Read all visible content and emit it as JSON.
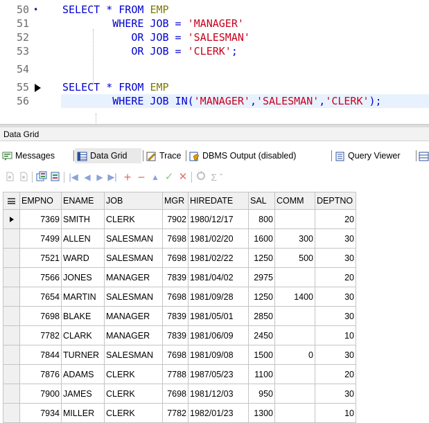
{
  "editor": {
    "lines": [
      {
        "num": "50",
        "marker": "•",
        "parts": [
          [
            "kw",
            "SELECT * FROM "
          ],
          [
            "tbl",
            "EMP"
          ]
        ]
      },
      {
        "num": "51",
        "marker": "",
        "parts": [
          [
            "kw",
            "        WHERE JOB = "
          ],
          [
            "str",
            "'MANAGER'"
          ]
        ]
      },
      {
        "num": "52",
        "marker": "",
        "parts": [
          [
            "kw",
            "           OR JOB = "
          ],
          [
            "str",
            "'SALESMAN'"
          ]
        ]
      },
      {
        "num": "53",
        "marker": "",
        "parts": [
          [
            "kw",
            "           OR JOB = "
          ],
          [
            "str",
            "'CLERK'"
          ],
          [
            "kw",
            ";"
          ]
        ]
      },
      {
        "num": "54",
        "marker": "",
        "parts": []
      },
      {
        "num": "55",
        "marker": "arrow",
        "parts": [
          [
            "kw",
            "SELECT * FROM "
          ],
          [
            "tbl",
            "EMP"
          ]
        ]
      },
      {
        "num": "56",
        "marker": "",
        "highlight": true,
        "parts": [
          [
            "kw",
            "        WHERE JOB IN("
          ],
          [
            "str",
            "'MANAGER'"
          ],
          [
            "kw",
            ","
          ],
          [
            "str",
            "'SALESMAN'"
          ],
          [
            "kw",
            ","
          ],
          [
            "str",
            "'CLERK'"
          ],
          [
            "kw",
            ");"
          ]
        ]
      }
    ]
  },
  "panel": {
    "title": "Data Grid"
  },
  "tabs": [
    {
      "label": "Messages",
      "icon": "messages-icon"
    },
    {
      "label": "Data Grid",
      "icon": "data-grid-icon",
      "active": true
    },
    {
      "label": "Trace",
      "icon": "trace-icon"
    },
    {
      "label": "DBMS Output (disabled)",
      "icon": "dbms-output-icon"
    },
    {
      "label": "Query Viewer",
      "icon": "query-viewer-icon"
    }
  ],
  "toolbar": {
    "buttons": [
      "copy-icon",
      "paste-icon",
      "export-icon",
      "import-icon",
      "first-record-icon",
      "prior-record-icon",
      "next-record-icon",
      "last-record-icon",
      "insert-record-icon",
      "delete-record-icon",
      "edit-record-icon",
      "post-edit-icon",
      "cancel-edit-icon",
      "refresh-icon",
      "sum-icon"
    ],
    "sum_label": "Σ ˇ"
  },
  "grid": {
    "columns": [
      "EMPNO",
      "ENAME",
      "JOB",
      "MGR",
      "HIREDATE",
      "SAL",
      "COMM",
      "DEPTNO"
    ],
    "rows": [
      [
        "7369",
        "SMITH",
        "CLERK",
        "7902",
        "1980/12/17",
        "800",
        "",
        "20"
      ],
      [
        "7499",
        "ALLEN",
        "SALESMAN",
        "7698",
        "1981/02/20",
        "1600",
        "300",
        "30"
      ],
      [
        "7521",
        "WARD",
        "SALESMAN",
        "7698",
        "1981/02/22",
        "1250",
        "500",
        "30"
      ],
      [
        "7566",
        "JONES",
        "MANAGER",
        "7839",
        "1981/04/02",
        "2975",
        "",
        "20"
      ],
      [
        "7654",
        "MARTIN",
        "SALESMAN",
        "7698",
        "1981/09/28",
        "1250",
        "1400",
        "30"
      ],
      [
        "7698",
        "BLAKE",
        "MANAGER",
        "7839",
        "1981/05/01",
        "2850",
        "",
        "30"
      ],
      [
        "7782",
        "CLARK",
        "MANAGER",
        "7839",
        "1981/06/09",
        "2450",
        "",
        "10"
      ],
      [
        "7844",
        "TURNER",
        "SALESMAN",
        "7698",
        "1981/09/08",
        "1500",
        "0",
        "30"
      ],
      [
        "7876",
        "ADAMS",
        "CLERK",
        "7788",
        "1987/05/23",
        "1100",
        "",
        "20"
      ],
      [
        "7900",
        "JAMES",
        "CLERK",
        "7698",
        "1981/12/03",
        "950",
        "",
        "30"
      ],
      [
        "7934",
        "MILLER",
        "CLERK",
        "7782",
        "1982/01/23",
        "1300",
        "",
        "10"
      ]
    ],
    "selected_row": 0
  },
  "colors": {
    "keyword": "#0000d0",
    "string": "#c8001c",
    "table": "#7a7a00",
    "highlight": "#e8f2fe"
  }
}
